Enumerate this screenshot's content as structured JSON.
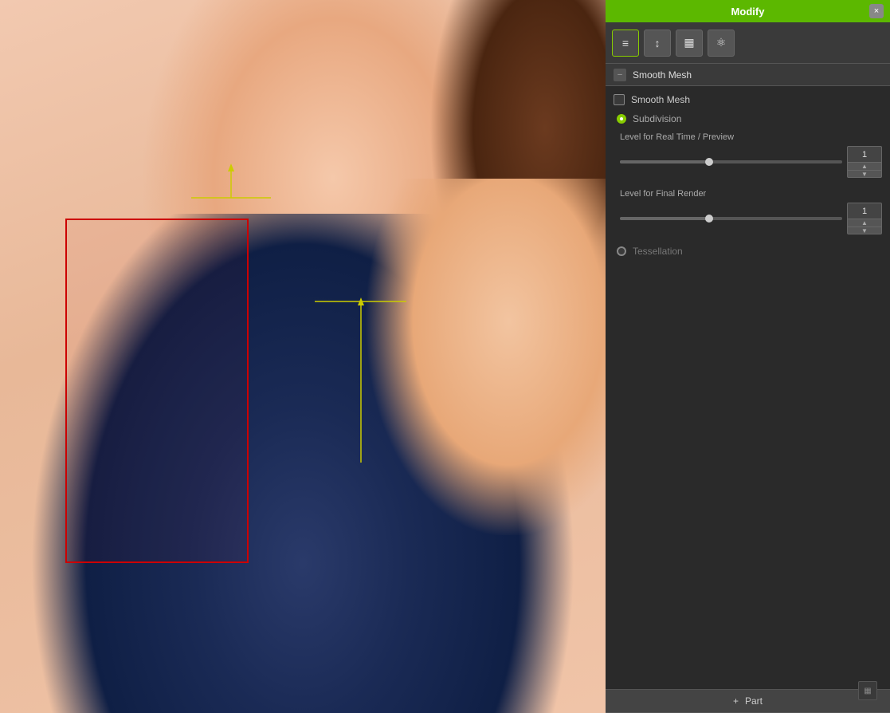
{
  "panel": {
    "title": "Modify",
    "close_label": "×",
    "section_title": "Smooth Mesh",
    "collapse_icon": "–",
    "smooth_mesh_label": "Smooth Mesh",
    "subdivision_label": "Subdivision",
    "level_realtime_label": "Level for Real Time / Preview",
    "level_realtime_value": "1",
    "level_render_label": "Level for Final Render",
    "level_render_value": "1",
    "tessellation_label": "Tessellation",
    "part_btn_label": "Part",
    "part_plus": "+"
  },
  "toolbar": {
    "icons": [
      "≡",
      "↕",
      "▦",
      "⚛"
    ]
  },
  "viewport": {
    "gizmo_color": "#cccc00",
    "selection_color": "#cc0000"
  }
}
